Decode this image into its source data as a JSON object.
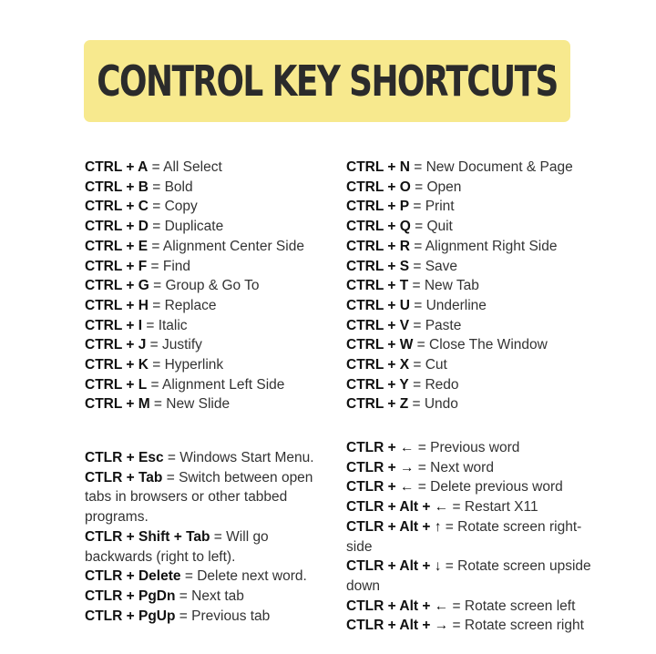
{
  "title": "CONTROL KEY SHORTCUTS",
  "left_top": [
    {
      "key": "CTRL + A",
      "desc": "All Select"
    },
    {
      "key": "CTRL + B",
      "desc": "Bold"
    },
    {
      "key": "CTRL + C",
      "desc": "Copy"
    },
    {
      "key": "CTRL + D",
      "desc": "Duplicate"
    },
    {
      "key": "CTRL + E",
      "desc": "Alignment Center Side"
    },
    {
      "key": "CTRL + F",
      "desc": "Find"
    },
    {
      "key": "CTRL + G",
      "desc": "Group & Go To"
    },
    {
      "key": "CTRL + H",
      "desc": "Replace"
    },
    {
      "key": "CTRL + I",
      "desc": "Italic"
    },
    {
      "key": "CTRL + J",
      "desc": "Justify"
    },
    {
      "key": "CTRL + K",
      "desc": "Hyperlink"
    },
    {
      "key": "CTRL + L",
      "desc": "Alignment Left Side"
    },
    {
      "key": "CTRL + M",
      "desc": "New Slide"
    }
  ],
  "right_top": [
    {
      "key": "CTRL + N",
      "desc": "New Document & Page"
    },
    {
      "key": "CTRL + O",
      "desc": "Open"
    },
    {
      "key": "CTRL + P",
      "desc": "Print"
    },
    {
      "key": "CTRL + Q",
      "desc": "Quit"
    },
    {
      "key": "CTRL + R",
      "desc": "Alignment Right Side"
    },
    {
      "key": "CTRL + S",
      "desc": "Save"
    },
    {
      "key": "CTRL + T",
      "desc": "New Tab"
    },
    {
      "key": "CTRL + U",
      "desc": "Underline"
    },
    {
      "key": "CTRL + V",
      "desc": "Paste"
    },
    {
      "key": "CTRL + W",
      "desc": "Close The Window"
    },
    {
      "key": "CTRL + X",
      "desc": "Cut"
    },
    {
      "key": "CTRL + Y",
      "desc": "Redo"
    },
    {
      "key": "CTRL + Z",
      "desc": "Undo"
    }
  ],
  "left_bottom": [
    {
      "key": "CTLR + Esc",
      "desc": "Windows Start Menu."
    },
    {
      "key": "CTLR + Tab",
      "desc": "Switch between open tabs in browsers or other tabbed programs."
    },
    {
      "key": "CTLR + Shift + Tab",
      "desc": "Will go backwards (right to left)."
    },
    {
      "key": "CTLR + Delete",
      "desc": "Delete next word."
    },
    {
      "key": "CTLR + PgDn",
      "desc": "Next tab"
    },
    {
      "key": "CTLR + PgUp",
      "desc": "Previous tab"
    }
  ],
  "right_bottom": [
    {
      "key": "CTLR + ←",
      "desc": "Previous word"
    },
    {
      "key": "CTLR  + →",
      "desc": "Next word"
    },
    {
      "key": "CTLR + ←",
      "desc": "Delete previous word"
    },
    {
      "key": "CTLR  + Alt + ←",
      "desc": "Restart X11"
    },
    {
      "key": "CTLR + Alt + ↑",
      "desc": "Rotate screen right-side"
    },
    {
      "key": "CTLR + Alt + ↓",
      "desc": "Rotate screen upside down"
    },
    {
      "key": "CTLR  + Alt + ←",
      "desc": "Rotate screen left"
    },
    {
      "key": "CTLR + Alt + →",
      "desc": "Rotate screen right"
    }
  ]
}
